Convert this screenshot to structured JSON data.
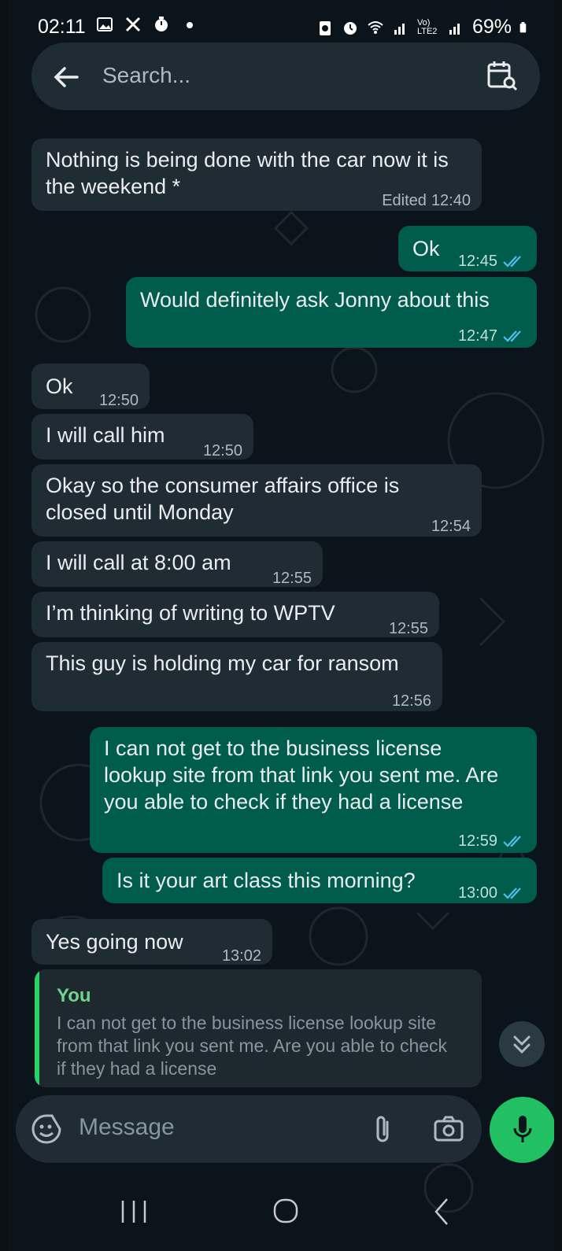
{
  "status_bar": {
    "time": "02:11",
    "network": "Vo) LTE2",
    "battery": "69%"
  },
  "header": {
    "search_placeholder": "Search..."
  },
  "messages": [
    {
      "direction": "in",
      "text": "Nothing is being done with the car now it is the weekend *",
      "edited_label": "Edited",
      "time": "12:40"
    },
    {
      "direction": "out",
      "text": "Ok",
      "time": "12:45",
      "status": "read"
    },
    {
      "direction": "out",
      "text": "Would definitely ask Jonny about this",
      "time": "12:47",
      "status": "read"
    },
    {
      "direction": "in",
      "text": "Ok",
      "time": "12:50"
    },
    {
      "direction": "in",
      "text": "I will call him",
      "time": "12:50"
    },
    {
      "direction": "in",
      "text": "Okay so the consumer affairs office is closed until Monday",
      "time": "12:54"
    },
    {
      "direction": "in",
      "text": "I will call at 8:00 am",
      "time": "12:55"
    },
    {
      "direction": "in",
      "text": "I’m thinking of writing to WPTV",
      "time": "12:55"
    },
    {
      "direction": "in",
      "text": "This guy is holding my car for ransom",
      "time": "12:56"
    },
    {
      "direction": "out",
      "text": "I can not get to the business license lookup site from that link you sent me. Are you able to check if they had a license",
      "time": "12:59",
      "status": "read"
    },
    {
      "direction": "out",
      "text": "Is it your art class this morning?",
      "time": "13:00",
      "status": "read"
    },
    {
      "direction": "in",
      "text": "Yes going now",
      "time": "13:02"
    }
  ],
  "reply_preview": {
    "author": "You",
    "text": "I can not get to the business license lookup site from that link you sent me. Are you able to check if they had a license"
  },
  "composer": {
    "placeholder": "Message"
  },
  "colors": {
    "background": "#0b141a",
    "incoming_bubble": "#202c33",
    "outgoing_bubble": "#005c4b",
    "accent_green": "#21c063",
    "read_ticks": "#53bdeb"
  }
}
